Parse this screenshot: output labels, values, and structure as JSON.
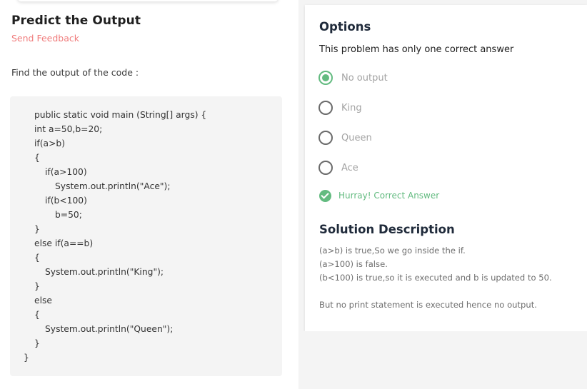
{
  "question": {
    "title": "Predict the Output",
    "feedback_link": "Send Feedback",
    "prompt": "Find the output of the code :",
    "code_lines": [
      "public static void main (String[] args) {",
      "int a=50,b=20;",
      "if(a>b)",
      "{",
      "if(a>100)",
      "System.out.println(\"Ace\");",
      "if(b<100)",
      "b=50;",
      "}",
      "else if(a==b)",
      "{",
      "System.out.println(\"King\");",
      "}",
      "else",
      "{",
      "System.out.println(\"Queen\");",
      "}",
      "}"
    ]
  },
  "options_panel": {
    "title": "Options",
    "subtitle": "This problem has only one correct answer",
    "options": [
      {
        "label": "No output",
        "selected": true
      },
      {
        "label": "King",
        "selected": false
      },
      {
        "label": "Queen",
        "selected": false
      },
      {
        "label": "Ace",
        "selected": false
      }
    ],
    "result": "Hurray! Correct Answer",
    "result_icon": "check-circle-icon"
  },
  "solution": {
    "title": "Solution Description",
    "lines": [
      "(a>b) is true,So we go inside the if.",
      "(a>100) is false.",
      "(b<100) is true,so it is executed and b is updated to 50.",
      "But no print statement is executed hence no output."
    ]
  },
  "colors": {
    "accent_green": "#63bb80",
    "feedback_red": "#f07d7d",
    "code_bg": "#f4f4f4"
  }
}
